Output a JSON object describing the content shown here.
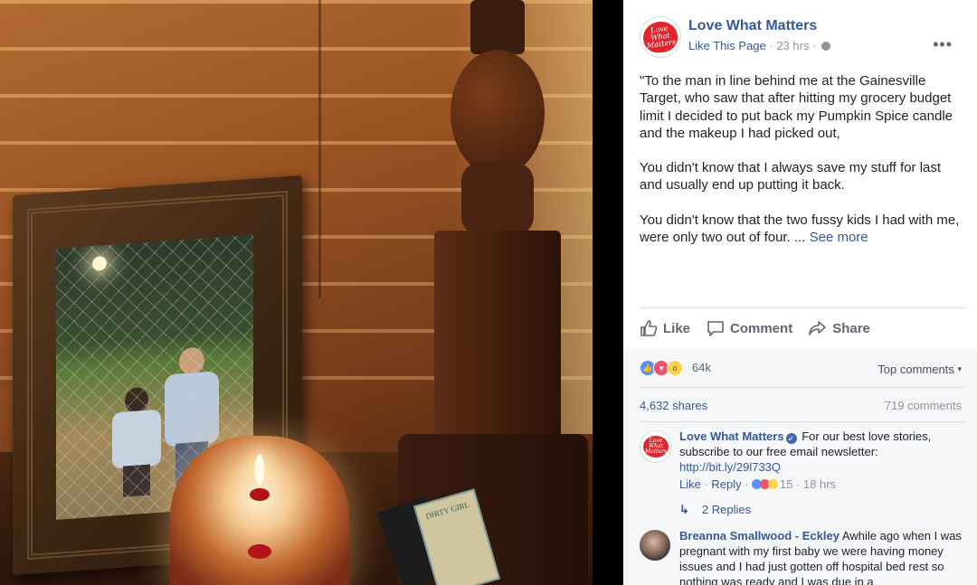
{
  "header": {
    "page_name": "Love What Matters",
    "like_page": "Like This Page",
    "separator": "·",
    "time": "23 hrs",
    "logo_text": "Love What Matters"
  },
  "post": {
    "paragraphs": [
      "\"To the man in line behind me at the Gainesville Target, who saw that after hitting my grocery budget limit I decided to put back my Pumpkin Spice candle and the makeup I had picked out,",
      "You didn't know that I always save my stuff for last and usually end up putting it back.",
      "You didn't know that the two fussy kids I had with me, were only two out of four. ..."
    ],
    "see_more": "See more"
  },
  "actions": {
    "like": "Like",
    "comment": "Comment",
    "share": "Share"
  },
  "stats": {
    "reaction_count": "64k",
    "top_comments": "Top comments",
    "shares": "4,632 shares",
    "comments": "719 comments"
  },
  "comments": [
    {
      "name": "Love What Matters",
      "text": "For our best love stories, subscribe to our free email newsletter:",
      "link": "http://bit.ly/29l733Q",
      "like": "Like",
      "reply": "Reply",
      "reaction_count": "15",
      "time": "18 hrs",
      "replies": "2 Replies"
    },
    {
      "name": "Breanna Smallwood - Eckley",
      "text": "Awhile ago when I was pregnant with my first baby we were having money issues and I had just gotten off hospital bed rest so nothing was ready and I was due in a"
    }
  ],
  "photo": {
    "makeup_label": "DIRTY GIRL"
  },
  "colors": {
    "link": "#365899",
    "like_reaction": "#5890ff",
    "love_reaction": "#f25268",
    "wow_reaction": "#fcd250"
  },
  "icons": [
    "more-options-icon",
    "globe-icon",
    "like-thumb-icon",
    "comment-bubble-icon",
    "share-arrow-icon",
    "verified-badge-icon",
    "reply-arrow-icon"
  ]
}
